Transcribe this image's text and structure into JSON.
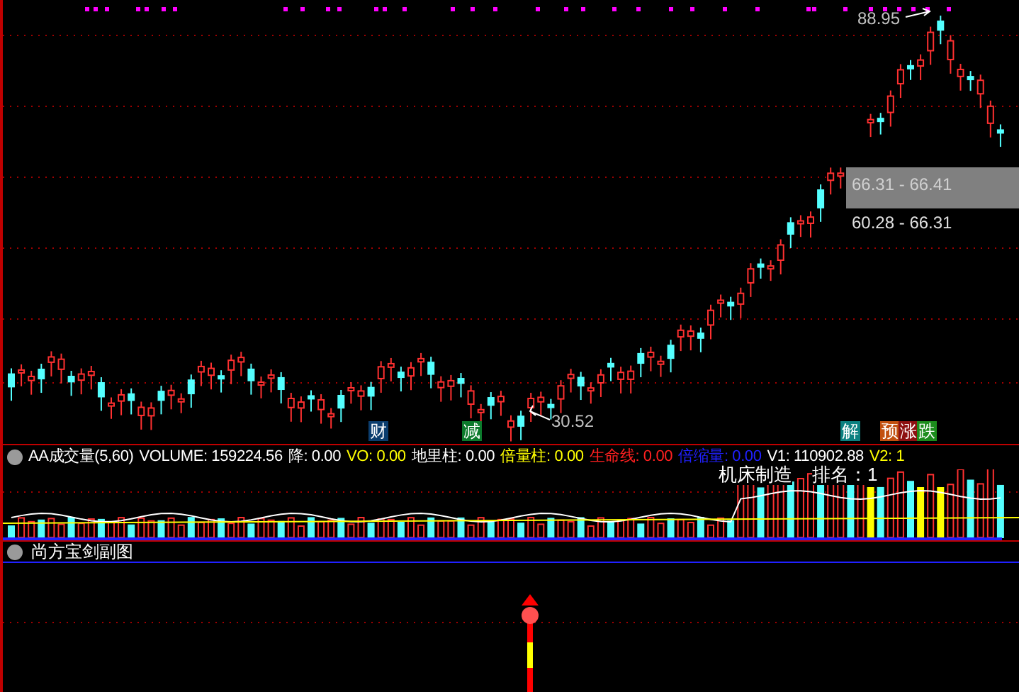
{
  "main_chart": {
    "high_label": "88.95",
    "low_label": "30.52",
    "range_labels": [
      {
        "text": "66.31 - 66.41",
        "selected": true
      },
      {
        "text": "60.28 - 66.31",
        "selected": false
      }
    ],
    "badges": [
      {
        "text": "财",
        "color": "#0b3d6e"
      },
      {
        "text": "减",
        "color": "#0c7a2c"
      },
      {
        "text": "解",
        "color": "#0b8080"
      },
      {
        "text": "预",
        "color": "#c2500f"
      },
      {
        "text": "涨",
        "color": "#8c1010"
      },
      {
        "text": "跌",
        "color": "#1c8c1c"
      }
    ]
  },
  "volume_panel": {
    "title": "AA成交量(5,60)",
    "fields": [
      {
        "text": "VOLUME: 159224.56",
        "color": "#ffffff"
      },
      {
        "text": "降: 0.00",
        "color": "#ffffff"
      },
      {
        "text": "VO: 0.00",
        "color": "#ffff00"
      },
      {
        "text": "地里柱: 0.00",
        "color": "#ffffff"
      },
      {
        "text": "倍量柱: 0.00",
        "color": "#ffff00"
      },
      {
        "text": "生命线: 0.00",
        "color": "#ff2020"
      },
      {
        "text": "倍缩量: 0.00",
        "color": "#2020ff"
      },
      {
        "text": "V1: 110902.88",
        "color": "#ffffff"
      },
      {
        "text": "V2: 1",
        "color": "#ffff00"
      }
    ],
    "industry": "机床制造",
    "rank": "排名：1"
  },
  "signal_panel": {
    "title": "尚方宝剑副图"
  }
}
